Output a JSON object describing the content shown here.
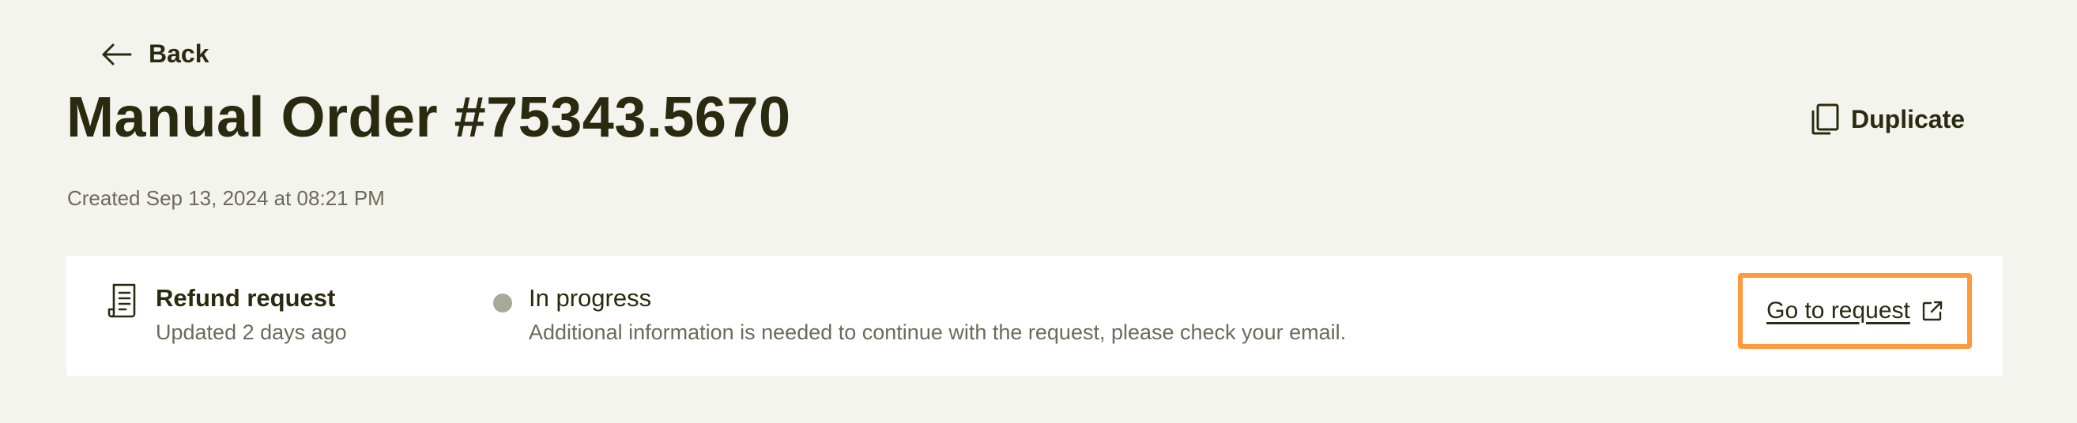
{
  "nav": {
    "back_label": "Back",
    "back_icon": "arrow-left-icon"
  },
  "header": {
    "title": "Manual Order #75343.5670",
    "created": "Created Sep 13, 2024 at 08:21 PM",
    "duplicate_label": "Duplicate",
    "duplicate_icon": "copy-icon"
  },
  "refund_card": {
    "icon": "receipt-icon",
    "title": "Refund request",
    "updated": "Updated 2 days ago",
    "status": {
      "label": "In progress",
      "dot_color": "#a9a99a",
      "description": "Additional information is needed to continue with the request, please check your email."
    },
    "action": {
      "label": "Go to request",
      "icon": "external-link-icon",
      "highlight_color": "#ff9a3c"
    }
  },
  "colors": {
    "background": "#f4f4ef",
    "text_primary": "#2a2a10",
    "text_secondary": "#6b6b5c",
    "card": "#ffffff"
  }
}
